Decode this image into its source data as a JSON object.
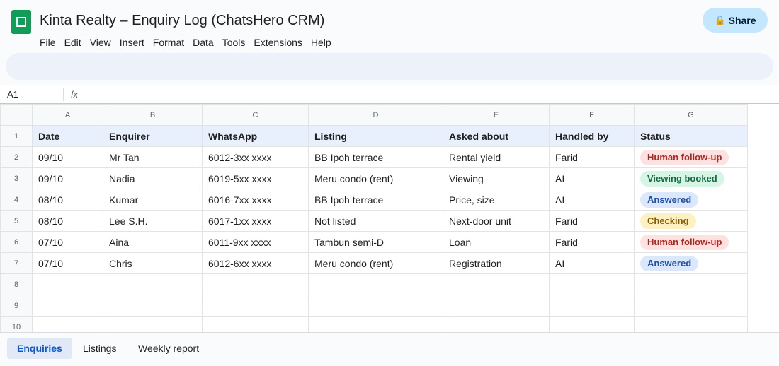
{
  "app": {
    "title": "Kinta Realty – Enquiry Log (ChatsHero CRM)",
    "share_label": "Share",
    "accent": "#0f9d58"
  },
  "menu": [
    "File",
    "Edit",
    "View",
    "Insert",
    "Format",
    "Data",
    "Tools",
    "Extensions",
    "Help"
  ],
  "formula_bar": {
    "cell_ref": "A1",
    "fx": "fx"
  },
  "grid": {
    "columns": [
      "A",
      "B",
      "C",
      "D",
      "E",
      "F",
      "G"
    ],
    "headers": [
      "Date",
      "Enquirer",
      "WhatsApp",
      "Listing",
      "Asked about",
      "Handled by",
      "Status"
    ],
    "rows": [
      {
        "date": "09/10",
        "enquirer": "Mr Tan",
        "whatsapp": "6012-3xx xxxx",
        "listing": "BB Ipoh terrace",
        "asked": "Rental yield",
        "handled": "Farid",
        "status": "Human follow-up",
        "status_color": "#b3261e"
      },
      {
        "date": "09/10",
        "enquirer": "Nadia",
        "whatsapp": "6019-5xx xxxx",
        "listing": "Meru condo (rent)",
        "asked": "Viewing",
        "handled": "AI",
        "status": "Viewing booked",
        "status_color": "#146c43"
      },
      {
        "date": "08/10",
        "enquirer": "Kumar",
        "whatsapp": "6016-7xx xxxx",
        "listing": "BB Ipoh terrace",
        "asked": "Price, size",
        "handled": "AI",
        "status": "Answered",
        "status_color": "#1f4fa8"
      },
      {
        "date": "08/10",
        "enquirer": "Lee S.H.",
        "whatsapp": "6017-1xx xxxx",
        "listing": "Not listed",
        "asked": "Next-door unit",
        "handled": "Farid",
        "status": "Checking",
        "status_color": "#8a5a00"
      },
      {
        "date": "07/10",
        "enquirer": "Aina",
        "whatsapp": "6011-9xx xxxx",
        "listing": "Tambun semi-D",
        "asked": "Loan",
        "handled": "Farid",
        "status": "Human follow-up",
        "status_color": "#b3261e"
      },
      {
        "date": "07/10",
        "enquirer": "Chris",
        "whatsapp": "6012-6xx xxxx",
        "listing": "Meru condo (rent)",
        "asked": "Registration",
        "handled": "AI",
        "status": "Answered",
        "status_color": "#1f4fa8"
      }
    ],
    "row_numbers": [
      "1",
      "2",
      "3",
      "4",
      "5",
      "6",
      "7",
      "8",
      "9",
      "10"
    ]
  },
  "tabs": [
    "Enquiries",
    "Listings",
    "Weekly report"
  ]
}
